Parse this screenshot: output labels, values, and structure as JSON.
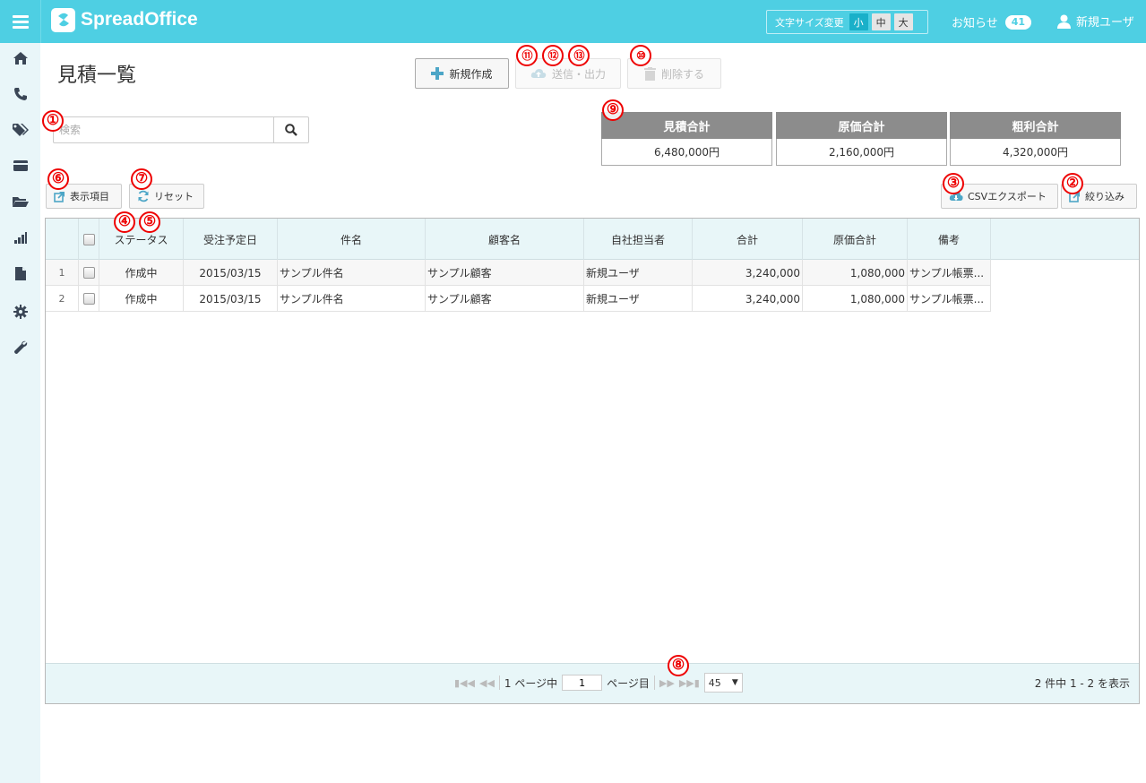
{
  "header": {
    "logo_text": "SpreadOffice",
    "font_size_label": "文字サイズ変更",
    "font_sizes": [
      "小",
      "中",
      "大"
    ],
    "notice_label": "お知らせ",
    "notice_count": "41",
    "user_name": "新規ユーザ"
  },
  "sidebar": {
    "items": [
      "home-icon",
      "phone-icon",
      "tags-icon",
      "card-icon",
      "folder-icon",
      "chart-icon",
      "file-icon",
      "gear-icon",
      "wrench-icon"
    ]
  },
  "page": {
    "title": "見積一覧"
  },
  "toolbar": {
    "new_label": "新規作成",
    "send_label": "送信・出力",
    "delete_label": "削除する"
  },
  "search": {
    "placeholder": "検索"
  },
  "totals": [
    {
      "label": "見積合計",
      "value": "6,480,000円"
    },
    {
      "label": "原価合計",
      "value": "2,160,000円"
    },
    {
      "label": "粗利合計",
      "value": "4,320,000円"
    }
  ],
  "list_tools": {
    "display_items": "表示項目",
    "reset": "リセット",
    "csv_export": "CSVエクスポート",
    "filter": "絞り込み"
  },
  "grid": {
    "columns": [
      "ステータス",
      "受注予定日",
      "件名",
      "顧客名",
      "自社担当者",
      "合計",
      "原価合計",
      "備考"
    ],
    "rows": [
      {
        "no": "1",
        "status": "作成中",
        "date": "2015/03/15",
        "subject": "サンプル件名",
        "customer": "サンプル顧客",
        "owner": "新規ユーザ",
        "total": "3,240,000",
        "cost": "1,080,000",
        "note": "サンプル帳票..."
      },
      {
        "no": "2",
        "status": "作成中",
        "date": "2015/03/15",
        "subject": "サンプル件名",
        "customer": "サンプル顧客",
        "owner": "新規ユーザ",
        "total": "3,240,000",
        "cost": "1,080,000",
        "note": "サンプル帳票..."
      }
    ]
  },
  "pager": {
    "total_pages_text": "1 ページ中",
    "current_page": "1",
    "page_suffix": "ページ目",
    "per_page": "45",
    "summary": "2 件中 1 - 2 を表示"
  },
  "annotations": [
    "①",
    "②",
    "③",
    "④",
    "⑤",
    "⑥",
    "⑦",
    "⑧",
    "⑨",
    "⑩",
    "⑪",
    "⑫",
    "⑬"
  ],
  "colors": {
    "brand": "#4ecfe3",
    "annotation": "#ee0000",
    "totals_header": "#8c8c8c"
  }
}
